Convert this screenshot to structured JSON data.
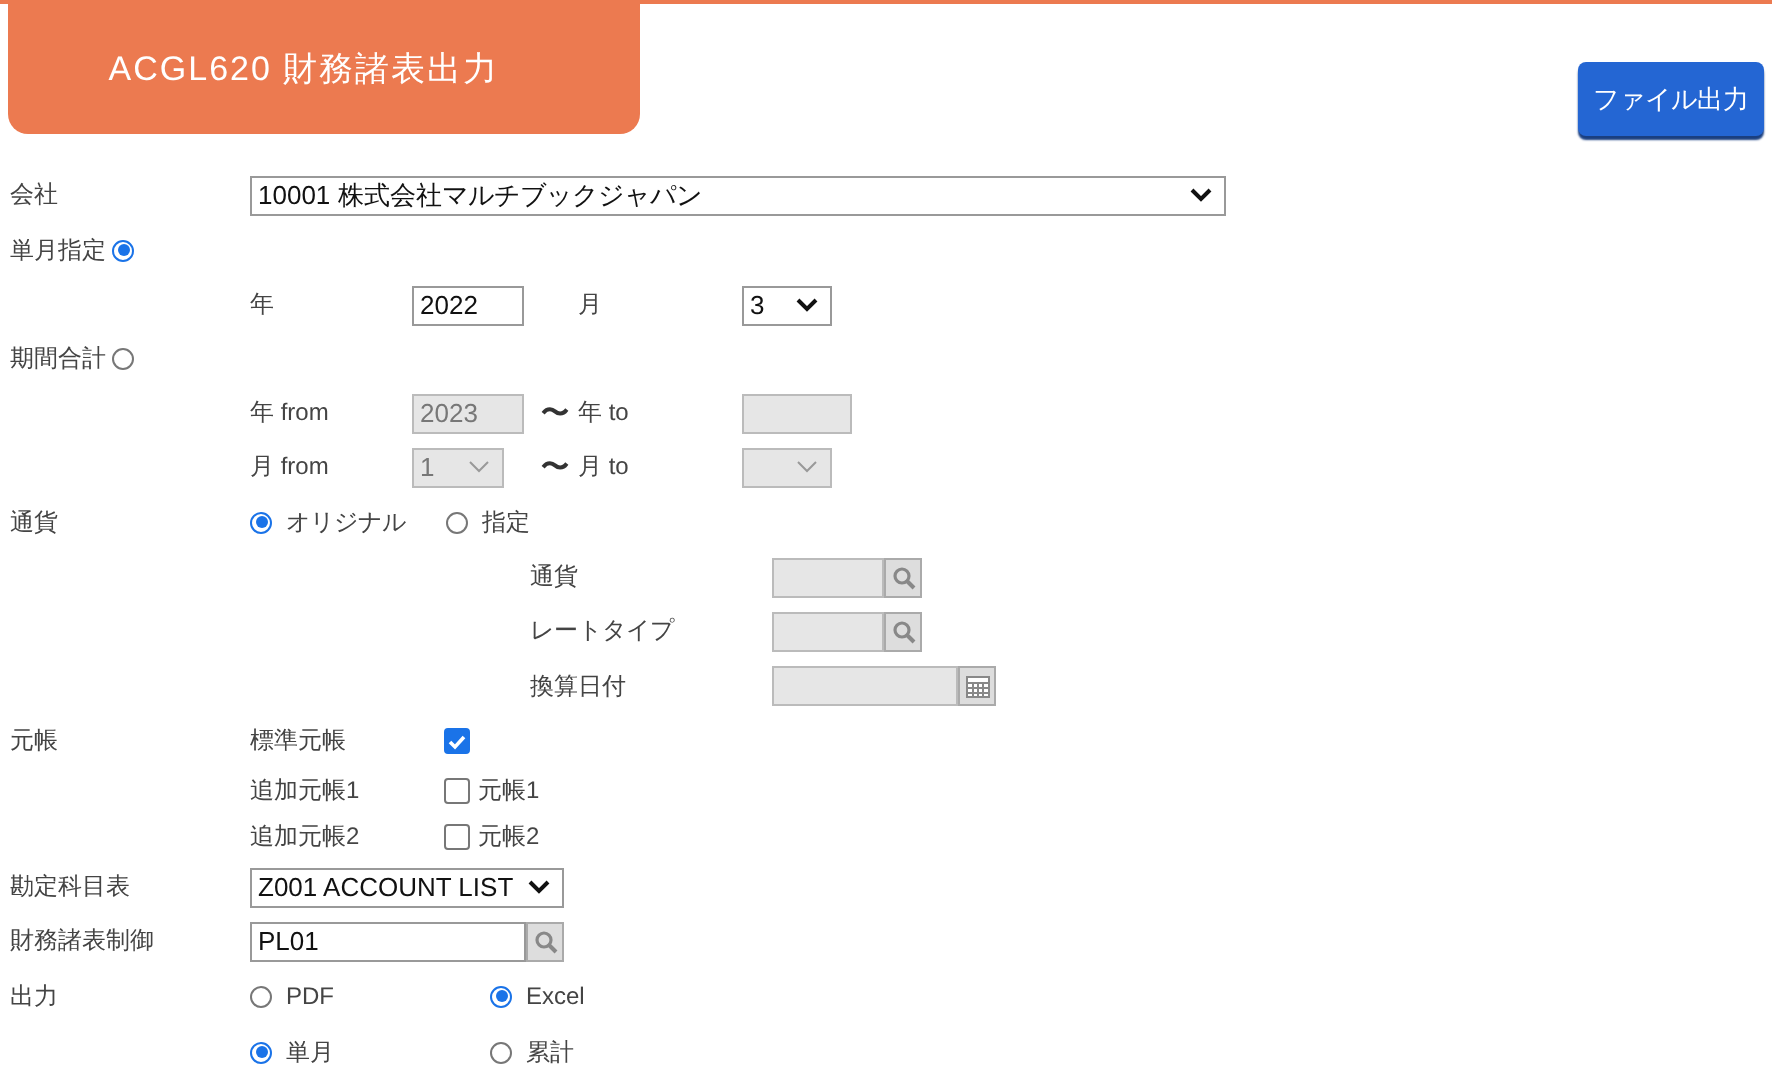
{
  "header": {
    "title": "ACGL620 財務諸表出力",
    "button": "ファイル出力"
  },
  "company": {
    "label": "会社",
    "value": "10001 株式会社マルチブックジャパン"
  },
  "single_month": {
    "label": "単月指定",
    "selected": true,
    "year_label": "年",
    "year": "2022",
    "month_label": "月",
    "month": "3"
  },
  "period_total": {
    "label": "期間合計",
    "selected": false,
    "disabled": true,
    "year_from_label": "年 from",
    "year_from": "2023",
    "tilde_1": "〜",
    "year_to_label": "年 to",
    "month_from_label": "月 from",
    "month_from": "1",
    "tilde_2": "〜",
    "month_to_label": "月 to"
  },
  "currency": {
    "label": "通貨",
    "options": [
      {
        "label": "オリジナル",
        "selected": true
      },
      {
        "label": "指定",
        "selected": false
      }
    ],
    "disabled": true,
    "fields": [
      {
        "label": "通貨",
        "kind": "lookup"
      },
      {
        "label": "レートタイプ",
        "kind": "lookup"
      },
      {
        "label": "換算日付",
        "kind": "date"
      }
    ]
  },
  "ledger": {
    "label": "元帳",
    "items": [
      {
        "label": "標準元帳",
        "checked": true
      },
      {
        "label": "追加元帳1",
        "checked": false,
        "text": "元帳1"
      },
      {
        "label": "追加元帳2",
        "checked": false,
        "text": "元帳2"
      }
    ]
  },
  "chart_of_accounts": {
    "label": "勘定科目表",
    "value": "Z001 ACCOUNT LIST"
  },
  "statement_control": {
    "label": "財務諸表制御",
    "value": "PL01"
  },
  "output": {
    "label": "出力",
    "formats": [
      {
        "label": "PDF",
        "selected": false
      },
      {
        "label": "Excel",
        "selected": true
      }
    ],
    "modes": [
      {
        "label": "単月",
        "selected": true
      },
      {
        "label": "累計",
        "selected": false
      }
    ]
  }
}
